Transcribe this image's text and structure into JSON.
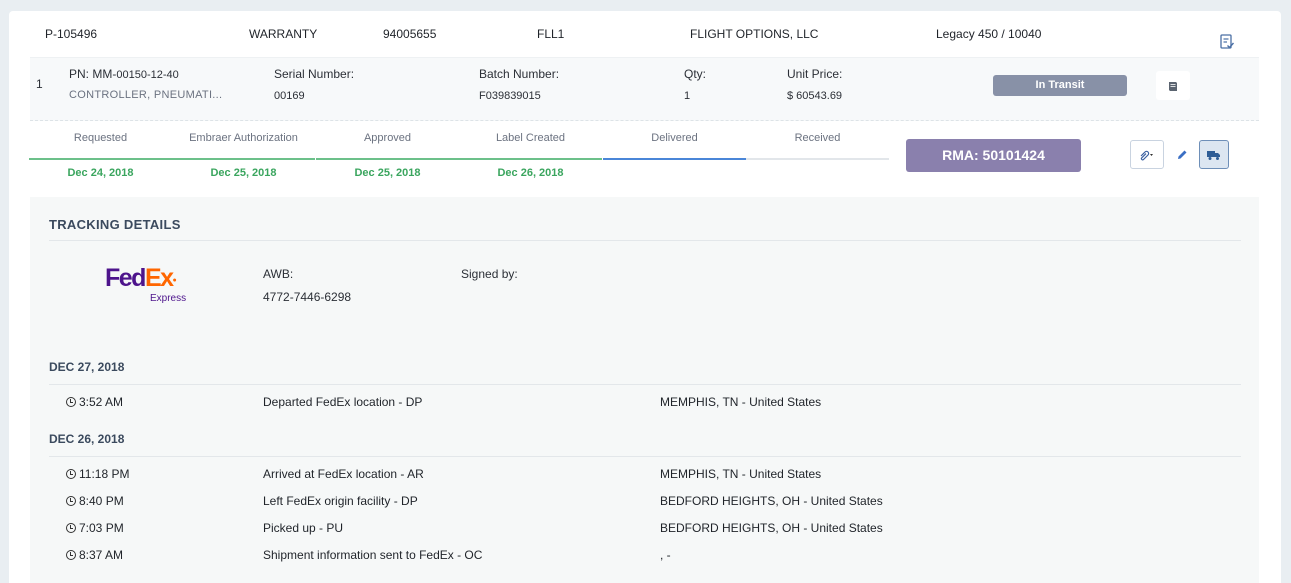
{
  "order": {
    "id": "P-105496",
    "type": "WARRANTY",
    "number": "94005655",
    "location": "FLL1",
    "customer": "FLIGHT OPTIONS, LLC",
    "aircraft": "Legacy 450 / 10040"
  },
  "line": {
    "index": "1",
    "pn_label": "PN:",
    "pn_prefix": "MM-",
    "pn_value": "00150-12-40",
    "description": "CONTROLLER, PNEUMATI...",
    "serial_label": "Serial Number:",
    "serial_value": "00169",
    "batch_label": "Batch Number:",
    "batch_value": "F039839015",
    "qty_label": "Qty:",
    "qty_value": "1",
    "price_label": "Unit Price:",
    "price_value": "$ 60543.69",
    "status": "In Transit"
  },
  "steps": [
    {
      "label": "Requested",
      "date": "Dec 24, 2018",
      "state": "done"
    },
    {
      "label": "Embraer Authorization",
      "date": "Dec 25, 2018",
      "state": "done"
    },
    {
      "label": "Approved",
      "date": "Dec 25, 2018",
      "state": "done"
    },
    {
      "label": "Label Created",
      "date": "Dec 26, 2018",
      "state": "done"
    },
    {
      "label": "Delivered",
      "date": "",
      "state": "current"
    },
    {
      "label": "Received",
      "date": "",
      "state": "pending"
    }
  ],
  "rma": "RMA: 50101424",
  "tracking": {
    "title": "TRACKING DETAILS",
    "carrier_fed": "Fed",
    "carrier_ex": "Ex",
    "carrier_sub": "Express",
    "awb_label": "AWB:",
    "awb_value": "4772-7446-6298",
    "signed_label": "Signed by:",
    "signed_value": "",
    "days": [
      {
        "date": "DEC 27, 2018",
        "events": [
          {
            "time": "3:52 AM",
            "desc": "Departed FedEx location - DP",
            "loc": "MEMPHIS, TN - United States"
          }
        ]
      },
      {
        "date": "DEC 26, 2018",
        "events": [
          {
            "time": "11:18 PM",
            "desc": "Arrived at FedEx location - AR",
            "loc": "MEMPHIS, TN - United States"
          },
          {
            "time": "8:40 PM",
            "desc": "Left FedEx origin facility - DP",
            "loc": "BEDFORD HEIGHTS, OH - United States"
          },
          {
            "time": "7:03 PM",
            "desc": "Picked up - PU",
            "loc": "BEDFORD HEIGHTS, OH - United States"
          },
          {
            "time": "8:37 AM",
            "desc": "Shipment information sent to FedEx - OC",
            "loc": ", -"
          }
        ]
      }
    ]
  },
  "icons": {
    "report": "clipboard-check-icon",
    "book": "book-icon",
    "attach": "paperclip-icon",
    "edit": "pencil-icon",
    "truck": "truck-icon",
    "clock": "clock-icon"
  },
  "colors": {
    "status_badge": "#8891a7",
    "rma_badge": "#8a80ad",
    "step_done": "#6cc08a",
    "step_current": "#4a86d8",
    "fedex_purple": "#4d148c",
    "fedex_orange": "#ff6600"
  }
}
